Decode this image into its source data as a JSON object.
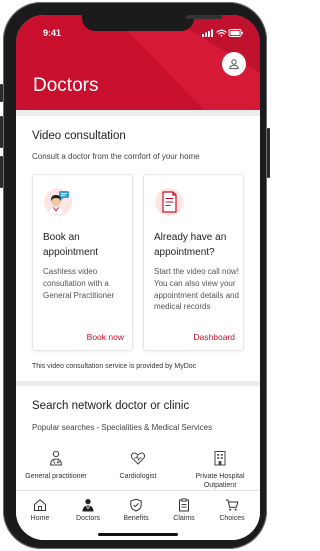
{
  "status_bar": {
    "time": "9:41"
  },
  "header": {
    "title": "Doctors",
    "brand_color": "#c8102e"
  },
  "video_consultation": {
    "title": "Video consultation",
    "subtitle": "Consult a doctor from the comfort of your home",
    "tiles": [
      {
        "icon": "doctor-avatar-icon",
        "heading": "Book an appointment",
        "body": "Cashless video consultation with a General Practitioner",
        "link": "Book now"
      },
      {
        "icon": "document-icon",
        "heading": "Already have an appointment?",
        "body": "Start the video call now! You can also view your appointment details and medical records",
        "link": "Dashboard"
      }
    ],
    "provider_note": "This video consultation service is provided by MyDoc"
  },
  "search_network": {
    "title": "Search network doctor or clinic",
    "subtitle": "Popular searches - Specialities & Medical Services",
    "categories": [
      {
        "label": "General practitioner",
        "icon": "stethoscope-person-icon",
        "selected": true
      },
      {
        "label": "Cardiologist",
        "icon": "heart-icon",
        "selected": false
      },
      {
        "label": "Private Hospital Outpatient",
        "icon": "hospital-icon",
        "selected": false
      }
    ]
  },
  "tabbar": {
    "items": [
      {
        "label": "Home",
        "icon": "home-icon",
        "active": false
      },
      {
        "label": "Doctors",
        "icon": "doctor-icon",
        "active": true
      },
      {
        "label": "Benefits",
        "icon": "shield-icon",
        "active": false
      },
      {
        "label": "Claims",
        "icon": "claims-icon",
        "active": false
      },
      {
        "label": "Choices",
        "icon": "cart-icon",
        "active": false
      }
    ]
  }
}
